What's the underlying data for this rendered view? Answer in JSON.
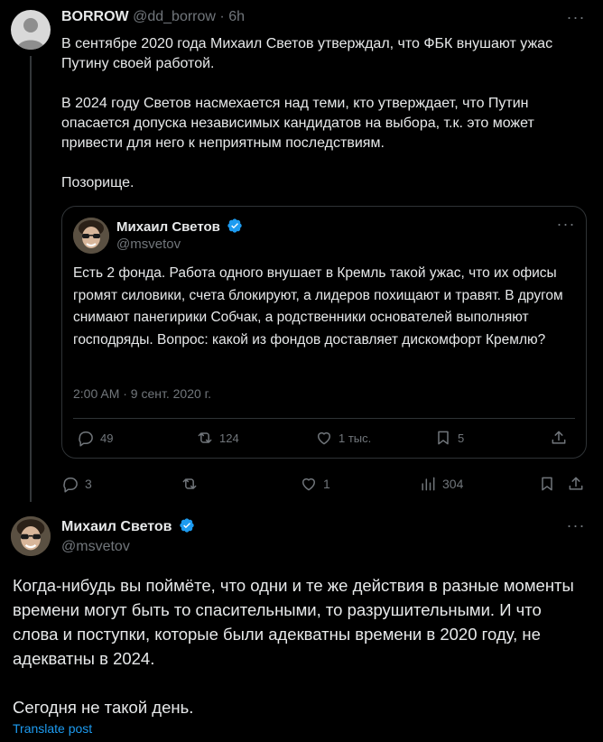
{
  "tweet": {
    "author_name": "BORROW",
    "author_handle": "@dd_borrow",
    "separator": "·",
    "time": "6h",
    "more_label": "···",
    "text": [
      "В сентябре 2020 года Михаил Светов утверждал, что ФБК внушают ужас Путину своей работой.",
      "В 2024 году Светов насмехается над теми, кто утверждает, что Путин опасается допуска независимых кандидатов на выбора, т.к. это может привести для него к неприятным последствиям.",
      "Позорище."
    ],
    "actions": {
      "replies": "3",
      "likes": "1",
      "views": "304"
    }
  },
  "quoted": {
    "author_name": "Михаил Светов",
    "author_handle": "@msvetov",
    "more_label": "···",
    "text": "Есть 2 фонда. Работа одного внушает в Кремль такой ужас, что их офисы громят силовики, счета блокируют, а лидеров похищают и травят. В другом снимают панегирики Собчак, а родственники основателей выполняют господряды. Вопрос: какой из фондов доставляет дискомфорт Кремлю?",
    "timestamp": "2:00 AM · 9 сент. 2020 г.",
    "actions": {
      "replies": "49",
      "reposts": "124",
      "likes": "1 тыс.",
      "bookmarks": "5"
    }
  },
  "reply": {
    "author_name": "Михаил Светов",
    "author_handle": "@msvetov",
    "more_label": "···",
    "text": [
      "Когда-нибудь вы поймёте, что одни и те же действия в разные моменты времени могут быть то спасительными, то разрушительными. И что слова и поступки, которые были адекватны времени в 2020 году, не адекватны в 2024.",
      "Сегодня не такой день."
    ],
    "translate_label": "Translate post"
  },
  "colors": {
    "background": "#000000",
    "text": "#e7e9ea",
    "muted": "#71767b",
    "border": "#2f3336",
    "link": "#1d9bf0",
    "verified": "#1d9bf0"
  }
}
